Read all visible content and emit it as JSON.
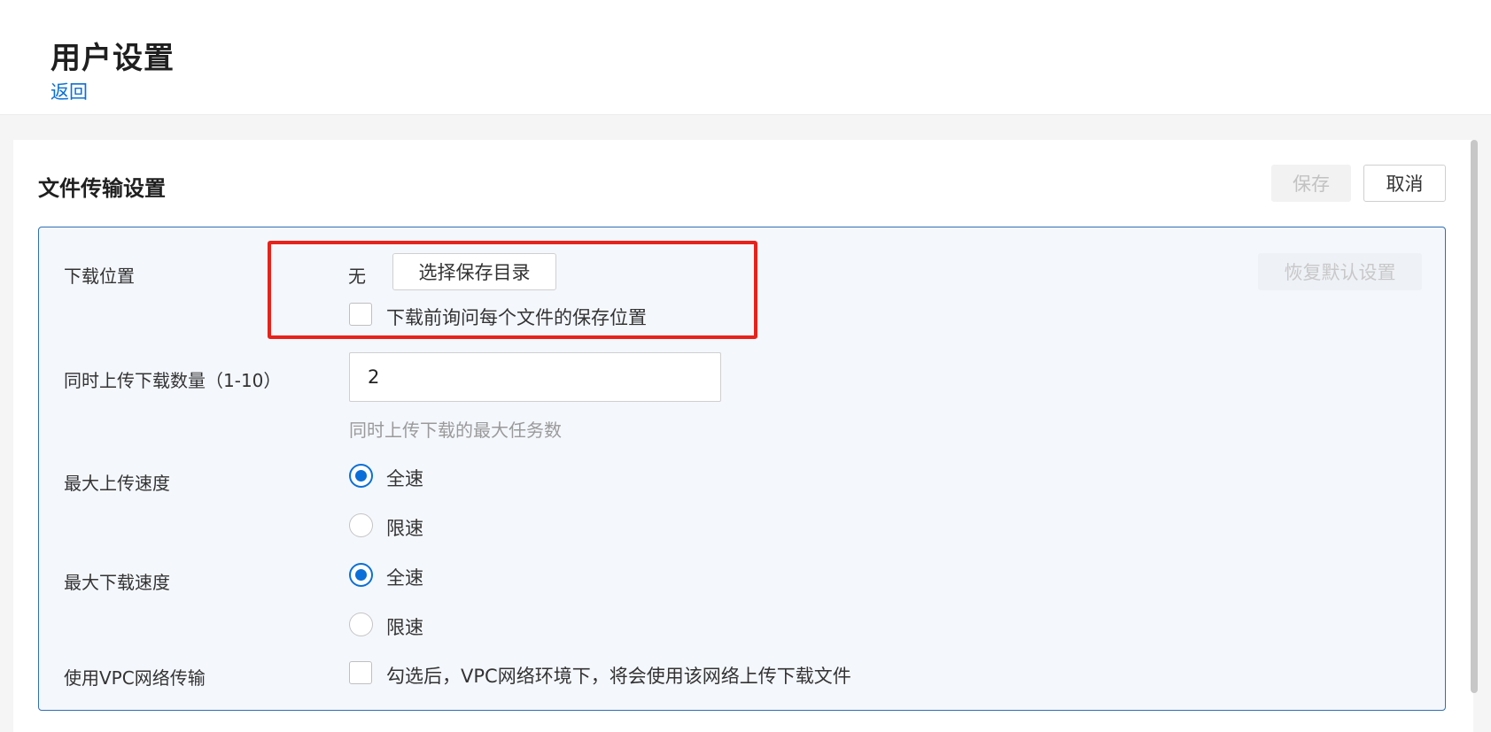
{
  "header": {
    "title": "用户设置",
    "back_label": "返回"
  },
  "section": {
    "title": "文件传输设置",
    "save_label": "保存",
    "cancel_label": "取消"
  },
  "form": {
    "restore_defaults_label": "恢复默认设置",
    "download_location": {
      "label": "下载位置",
      "value": "无",
      "choose_button_label": "选择保存目录",
      "ask_each_file_label": "下载前询问每个文件的保存位置",
      "ask_each_file_checked": false
    },
    "concurrent": {
      "label": "同时上传下载数量（1-10）",
      "value": "2",
      "hint": "同时上传下载的最大任务数"
    },
    "max_upload_speed": {
      "label": "最大上传速度",
      "options": [
        {
          "label": "全速",
          "checked": true
        },
        {
          "label": "限速",
          "checked": false
        }
      ]
    },
    "max_download_speed": {
      "label": "最大下载速度",
      "options": [
        {
          "label": "全速",
          "checked": true
        },
        {
          "label": "限速",
          "checked": false
        }
      ]
    },
    "vpc": {
      "label": "使用VPC网络传输",
      "option_label": "勾选后，VPC网络环境下，将会使用该网络上传下载文件",
      "checked": false
    }
  },
  "colors": {
    "accent": "#0a6fd8",
    "highlight_border": "#e8221b",
    "form_border": "#2f6fb3",
    "form_background": "#f4f7fc"
  }
}
